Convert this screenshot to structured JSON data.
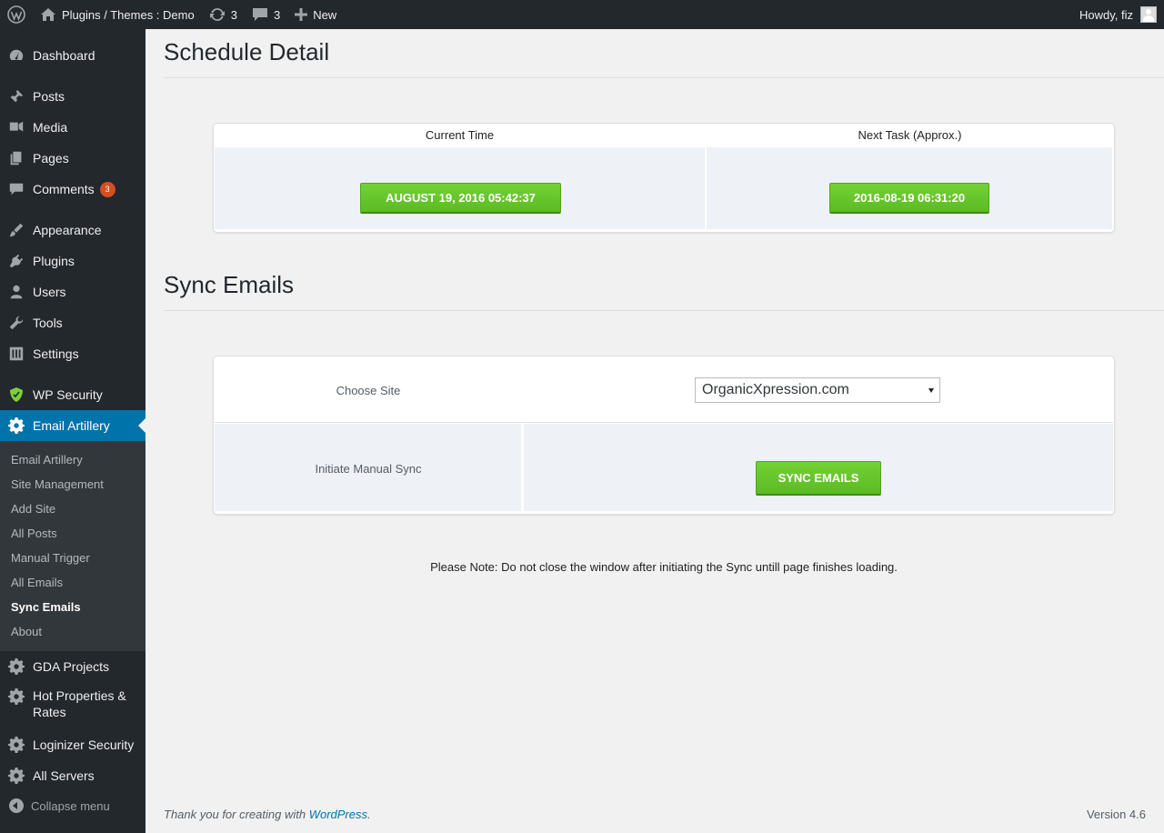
{
  "adminbar": {
    "site_name": "Plugins / Themes : Demo",
    "updates_count": "3",
    "comments_count": "3",
    "new_label": "New",
    "greeting": "Howdy, fiz"
  },
  "sidebar": {
    "items": [
      {
        "label": "Dashboard",
        "icon": "dashboard-icon"
      },
      {
        "label": "Posts",
        "icon": "pin-icon"
      },
      {
        "label": "Media",
        "icon": "media-icon"
      },
      {
        "label": "Pages",
        "icon": "pages-icon"
      },
      {
        "label": "Comments",
        "icon": "comments-icon",
        "badge": "3"
      },
      {
        "label": "Appearance",
        "icon": "brush-icon"
      },
      {
        "label": "Plugins",
        "icon": "plugin-icon"
      },
      {
        "label": "Users",
        "icon": "user-icon"
      },
      {
        "label": "Tools",
        "icon": "wrench-icon"
      },
      {
        "label": "Settings",
        "icon": "settings-icon"
      },
      {
        "label": "WP Security",
        "icon": "shield-icon"
      },
      {
        "label": "Email Artillery",
        "icon": "gear-icon"
      },
      {
        "label": "GDA Projects",
        "icon": "gear-icon"
      },
      {
        "label": "Hot Properties &",
        "label2": "Rates",
        "icon": "gear-icon"
      },
      {
        "label": "Loginizer Security",
        "icon": "gear-icon"
      },
      {
        "label": "All Servers",
        "icon": "gear-icon"
      }
    ],
    "submenu": [
      "Email Artillery",
      "Site Management",
      "Add Site",
      "All Posts",
      "Manual Trigger",
      "All Emails",
      "Sync Emails",
      "About"
    ],
    "collapse_label": "Collapse menu"
  },
  "schedule": {
    "title": "Schedule Detail",
    "current_time_label": "Current Time",
    "next_task_label": "Next Task (Approx.)",
    "current_time_value": "AUGUST 19, 2016 05:42:37",
    "next_task_value": "2016-08-19 06:31:20"
  },
  "sync": {
    "title": "Sync Emails",
    "choose_site_label": "Choose Site",
    "site_selected": "OrganicXpression.com",
    "manual_sync_label": "Initiate Manual Sync",
    "sync_button_label": "SYNC EMAILS",
    "note": "Please Note: Do not close the window after initiating the Sync untill page finishes loading."
  },
  "footer": {
    "thanks_prefix": "Thank you for creating with ",
    "wordpress_link": "WordPress",
    "thanks_suffix": ".",
    "version": "Version 4.6"
  },
  "colors": {
    "admin_bar": "#23282d",
    "accent": "#0073aa",
    "green_button": "#6ac72e",
    "badge": "#d54e21"
  }
}
